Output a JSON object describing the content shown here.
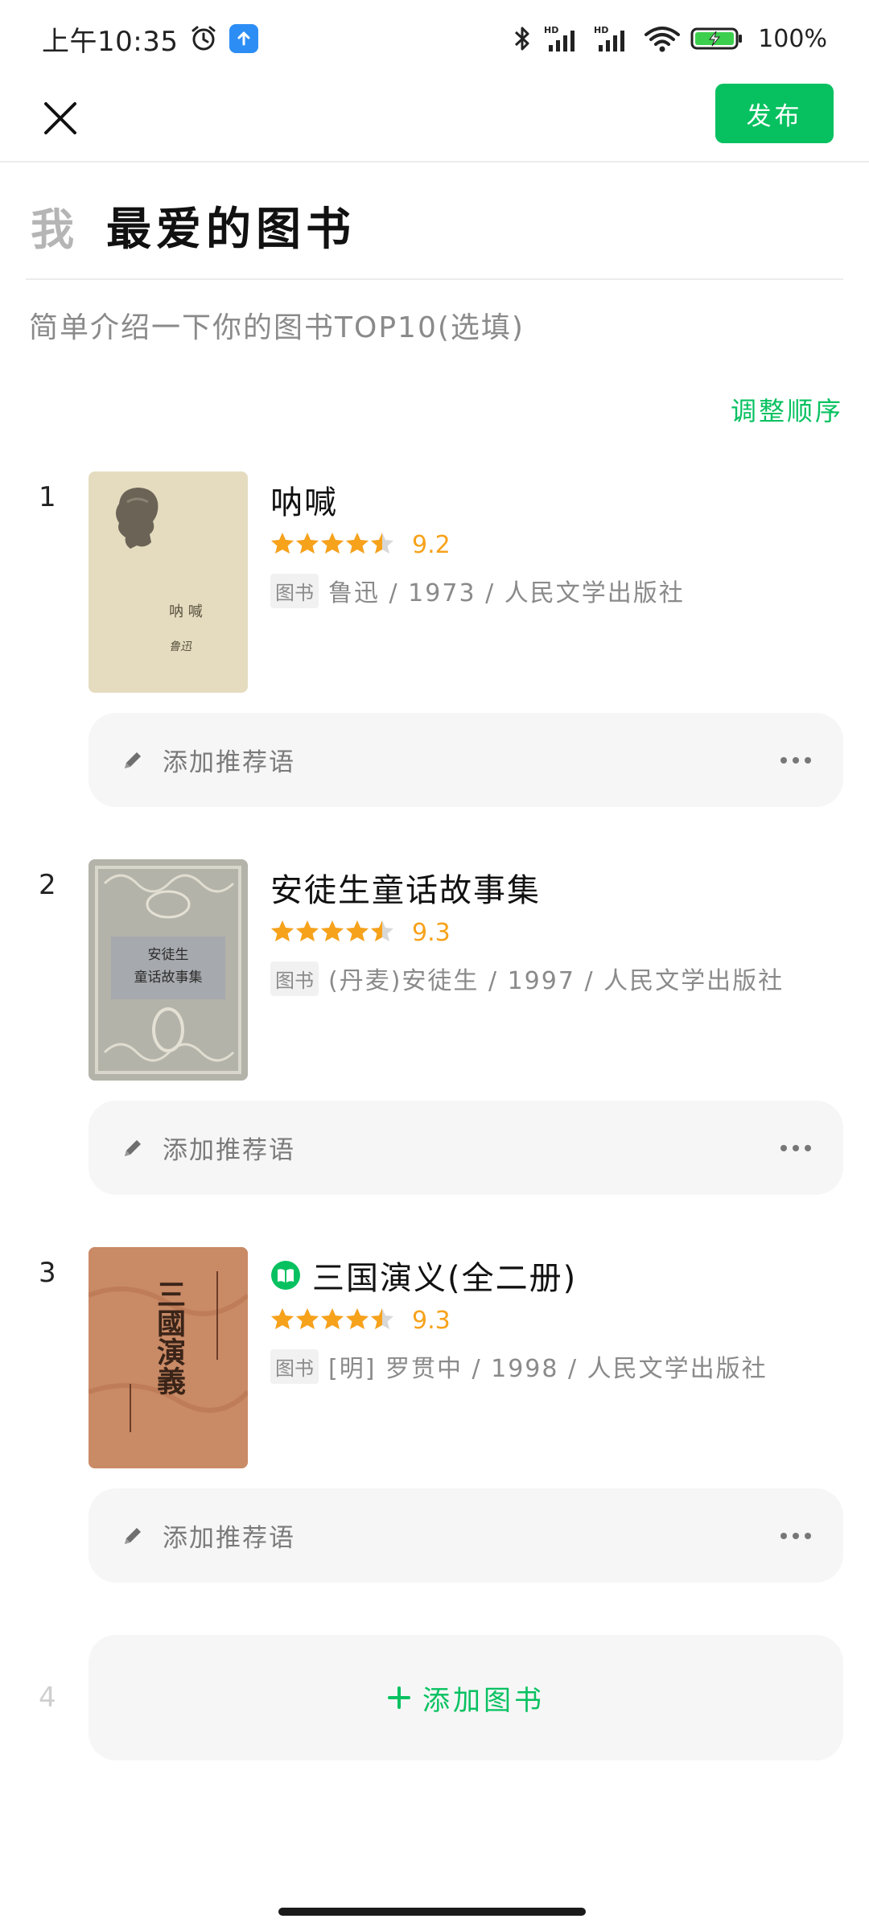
{
  "status_bar": {
    "time": "上午10:35",
    "battery": "100%"
  },
  "header": {
    "publish_label": "发布"
  },
  "title": {
    "prefix": "我",
    "main": "最爱的图书"
  },
  "intro": {
    "placeholder": "简单介绍一下你的图书TOP10(选填)"
  },
  "reorder_label": "调整顺序",
  "books": [
    {
      "rank": "1",
      "title": "呐喊",
      "rating": "9.2",
      "stars": 4.5,
      "tag": "图书",
      "meta": "鲁迅 / 1973 / 人民文学出版社",
      "recommend_placeholder": "添加推荐语",
      "cover_text": "呐 喊",
      "cover_signature": "鲁迅"
    },
    {
      "rank": "2",
      "title": "安徒生童话故事集",
      "rating": "9.3",
      "stars": 4.5,
      "tag": "图书",
      "meta": "(丹麦)安徒生 / 1997 / 人民文学出版社",
      "recommend_placeholder": "添加推荐语",
      "cover_text_1": "安徒生",
      "cover_text_2": "童话故事集"
    },
    {
      "rank": "3",
      "title": "三国演义(全二册)",
      "rating": "9.3",
      "stars": 4.5,
      "tag": "图书",
      "meta": "[明] 罗贯中 / 1998 / 人民文学出版社",
      "recommend_placeholder": "添加推荐语",
      "cover_text": "三國演義"
    }
  ],
  "add_book": {
    "rank": "4",
    "label": "添加图书"
  },
  "colors": {
    "accent": "#07c160",
    "star": "#f7a21b"
  }
}
